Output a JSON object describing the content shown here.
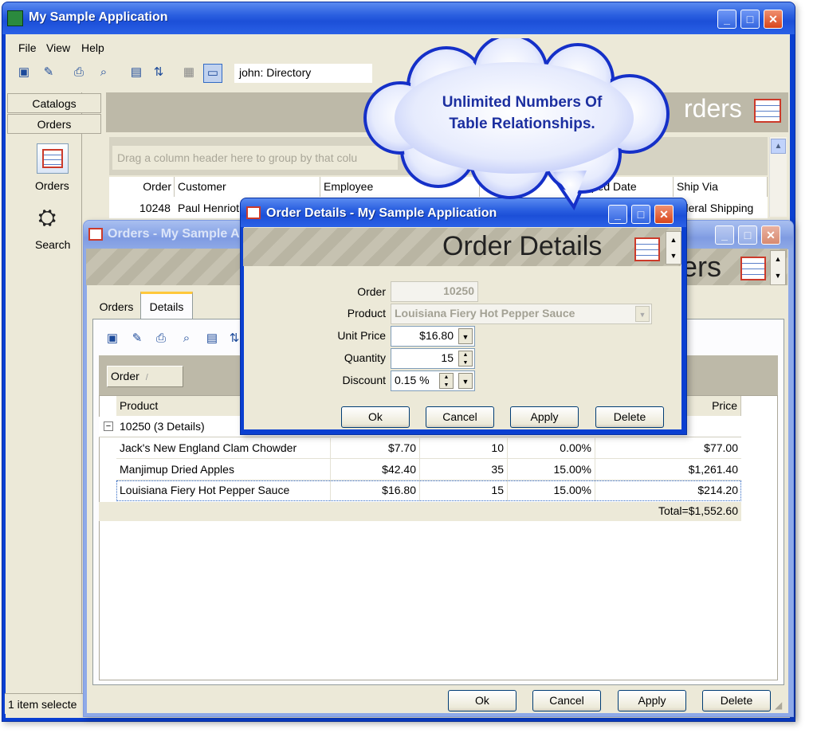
{
  "main": {
    "title": "My Sample Application",
    "menu": {
      "file": "File",
      "view": "View",
      "help": "Help"
    },
    "directory_combo": "john: Directory",
    "nav": {
      "catalogs": "Catalogs",
      "orders": "Orders",
      "orders_icon_label": "Orders",
      "search_label": "Search"
    },
    "header_title": "rders",
    "group_hint": "Drag a column header here to group by that colu",
    "columns": [
      "Order",
      "Customer",
      "Employee",
      "pped Date",
      "Ship Via"
    ],
    "row": {
      "order": "10248",
      "customer": "Paul Henriot",
      "ship_via": "ederal Shipping"
    },
    "status": "1 item selecte"
  },
  "callout": {
    "line1": "Unlimited Numbers Of",
    "line2": "Table Relationships."
  },
  "orders_window": {
    "title": "Orders - My Sample Application",
    "header_title": "ers",
    "tabs": [
      "Orders",
      "Details"
    ],
    "group_chip": "Order",
    "columns": {
      "product": "Product",
      "price": "Price"
    },
    "group_row": "10250 (3 Details)",
    "rows": [
      {
        "product": "Jack's New England Clam Chowder",
        "unit_price": "$7.70",
        "qty": "10",
        "discount": "0.00%",
        "price": "$77.00"
      },
      {
        "product": "Manjimup Dried Apples",
        "unit_price": "$42.40",
        "qty": "35",
        "discount": "15.00%",
        "price": "$1,261.40"
      },
      {
        "product": "Louisiana Fiery Hot Pepper Sauce",
        "unit_price": "$16.80",
        "qty": "15",
        "discount": "15.00%",
        "price": "$214.20"
      }
    ],
    "total": "Total=$1,552.60",
    "buttons": {
      "ok": "Ok",
      "cancel": "Cancel",
      "apply": "Apply",
      "delete": "Delete"
    }
  },
  "details_dialog": {
    "title": "Order Details - My Sample Application",
    "header_title": "Order Details",
    "labels": {
      "order": "Order",
      "product": "Product",
      "unit_price": "Unit Price",
      "quantity": "Quantity",
      "discount": "Discount"
    },
    "values": {
      "order": "10250",
      "product": "Louisiana Fiery Hot Pepper Sauce",
      "unit_price": "$16.80",
      "quantity": "15",
      "discount": "0.15 %"
    },
    "buttons": {
      "ok": "Ok",
      "cancel": "Cancel",
      "apply": "Apply",
      "delete": "Delete"
    }
  },
  "colors": {
    "xp_blue": "#0a3fd1",
    "face": "#ece9d8",
    "header_gray": "#bdb9a8",
    "callout_text": "#1c2fa0"
  }
}
